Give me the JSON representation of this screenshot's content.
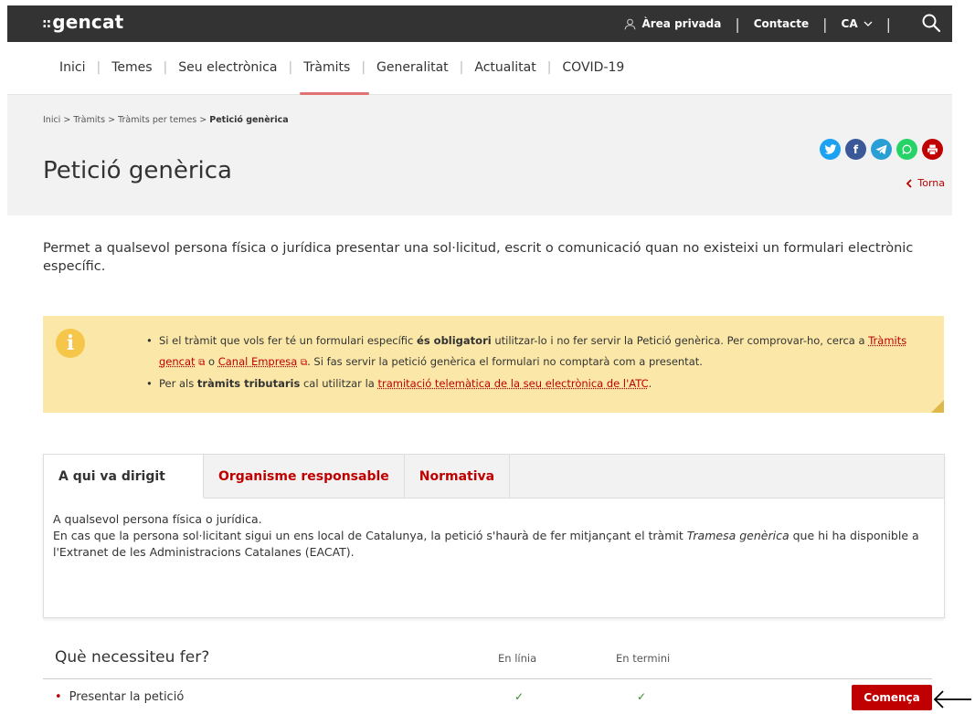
{
  "header": {
    "logo_mark": "::",
    "logo_text": "gencat",
    "private_area": "Àrea privada",
    "contact": "Contacte",
    "language": "CA",
    "separator": "|"
  },
  "mainnav": {
    "items": [
      {
        "label": "Inici"
      },
      {
        "label": "Temes"
      },
      {
        "label": "Seu electrònica"
      },
      {
        "label": "Tràmits",
        "active": true
      },
      {
        "label": "Generalitat"
      },
      {
        "label": "Actualitat"
      },
      {
        "label": "COVID-19"
      }
    ]
  },
  "breadcrumb": {
    "items": [
      "Inici",
      "Tràmits",
      "Tràmits per temes"
    ],
    "separator": ">",
    "current": "Petició genèrica"
  },
  "page": {
    "title": "Petició genèrica",
    "back_label": "Torna",
    "intro": "Permet a qualsevol persona física o jurídica presentar una sol·licitud, escrit o comunicació quan no existeixi un formulari electrònic específic."
  },
  "social": {
    "twitter": "t",
    "facebook": "f",
    "telegram": "➤",
    "whatsapp": "w",
    "print": "⎙"
  },
  "note": {
    "icon_label": "i",
    "item1_a": "Si el tràmit que vols fer té un formulari específic ",
    "item1_b": "és obligatori",
    "item1_c": " utilitzar-lo i no fer servir la Petició genèrica. Per comprovar-ho, cerca a ",
    "item1_link1": "Tràmits gencat",
    "item1_d": " o ",
    "item1_link2": "Canal Empresa",
    "item1_e": ". Si fas servir la petició genèrica el formulari no comptarà com a presentat.",
    "item2_a": "Per als ",
    "item2_b": "tràmits tributaris",
    "item2_c": " cal utilitzar la ",
    "item2_link": "tramitació telemàtica de la seu electrònica de l'ATC",
    "item2_d": ".",
    "ext_icon": "⧉"
  },
  "tabs": {
    "items": [
      "A qui va dirigit",
      "Organisme responsable",
      "Normativa"
    ],
    "active_index": 0,
    "body_line1": "A qualsevol persona física o jurídica.",
    "body_line2_a": "En cas que la persona sol·licitant sigui un ens local de Catalunya, la petició s'haurà de fer mitjançant el tràmit ",
    "body_line2_em": "Tramesa genèrica",
    "body_line2_b": " que hi ha disponible a l'Extranet de les Administracions Catalanes (EACAT)."
  },
  "needs": {
    "title": "Què necessiteu fer?",
    "col_online": "En línia",
    "col_term": "En termini",
    "rows": [
      {
        "label": "Presentar la petició",
        "online": "✓",
        "term": "✓",
        "action": "Comença"
      }
    ]
  },
  "colors": {
    "brand_red": "#c00000",
    "header_dark": "#333333",
    "note_bg": "#fbe8a8",
    "twitter": "#1da1f2",
    "facebook": "#3b5998",
    "telegram": "#2a9fd6",
    "whatsapp": "#25d366",
    "print": "#c00000"
  }
}
